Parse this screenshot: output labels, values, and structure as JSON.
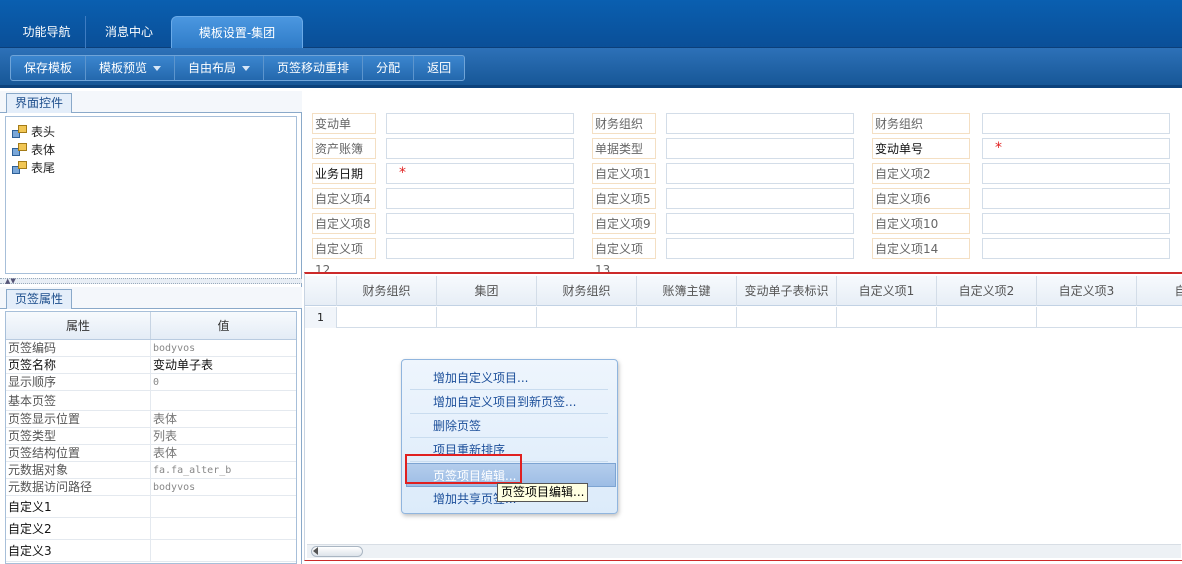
{
  "top_tabs": [
    {
      "label": "功能导航"
    },
    {
      "label": "消息中心"
    },
    {
      "label": "模板设置-集团",
      "active": true
    }
  ],
  "toolbar": {
    "save_template": "保存模板",
    "template_preview": "模板预览",
    "free_layout": "自由布局",
    "tab_reorder": "页签移动重排",
    "assign": "分配",
    "back": "返回"
  },
  "left_panel": {
    "ui_controls_tab": "界面控件",
    "tree": [
      "表头",
      "表体",
      "表尾"
    ],
    "tab_props_tab": "页签属性",
    "prop_header": {
      "key": "属性",
      "value": "值"
    },
    "props": [
      {
        "key": "页签编码",
        "value": "bodyvos"
      },
      {
        "key": "页签名称",
        "value": "变动单子表"
      },
      {
        "key": "显示顺序",
        "value": "0"
      },
      {
        "key": "基本页签",
        "value": ""
      },
      {
        "key": "页签显示位置",
        "value": "表体"
      },
      {
        "key": "页签类型",
        "value": "列表"
      },
      {
        "key": "页签结构位置",
        "value": "表体"
      },
      {
        "key": "元数据对象",
        "value": "fa.fa_alter_b"
      },
      {
        "key": "元数据访问路径",
        "value": "bodyvos"
      },
      {
        "key": "自定义1",
        "value": ""
      },
      {
        "key": "自定义2",
        "value": ""
      },
      {
        "key": "自定义3",
        "value": ""
      }
    ]
  },
  "form": {
    "rows": [
      [
        "变动单",
        "财务组织",
        "财务组织"
      ],
      [
        "资产账簿",
        "单据类型",
        "变动单号"
      ],
      [
        "业务日期",
        "自定义项1",
        "自定义项2"
      ],
      [
        "自定义项4",
        "自定义项5",
        "自定义项6"
      ],
      [
        "自定义项8",
        "自定义项9",
        "自定义项10"
      ],
      [
        "自定义项12",
        "自定义项13",
        "自定义项14"
      ]
    ],
    "required_mark": "*"
  },
  "grid": {
    "columns": [
      "财务组织",
      "集团",
      "财务组织",
      "账簿主键",
      "变动单子表标识",
      "自定义项1",
      "自定义项2",
      "自定义项3",
      "自定"
    ],
    "row_number": "1"
  },
  "context_menu": {
    "items": [
      "增加自定义项目...",
      "增加自定义项目到新页签...",
      "删除页签",
      "项目重新排序",
      "页签项目编辑...",
      "增加共享页签..."
    ],
    "tooltip": "页签项目编辑..."
  },
  "colors": {
    "header_blue": "#0a5fb0",
    "highlight_red": "#e02020",
    "menu_text": "#1c4f9a"
  }
}
